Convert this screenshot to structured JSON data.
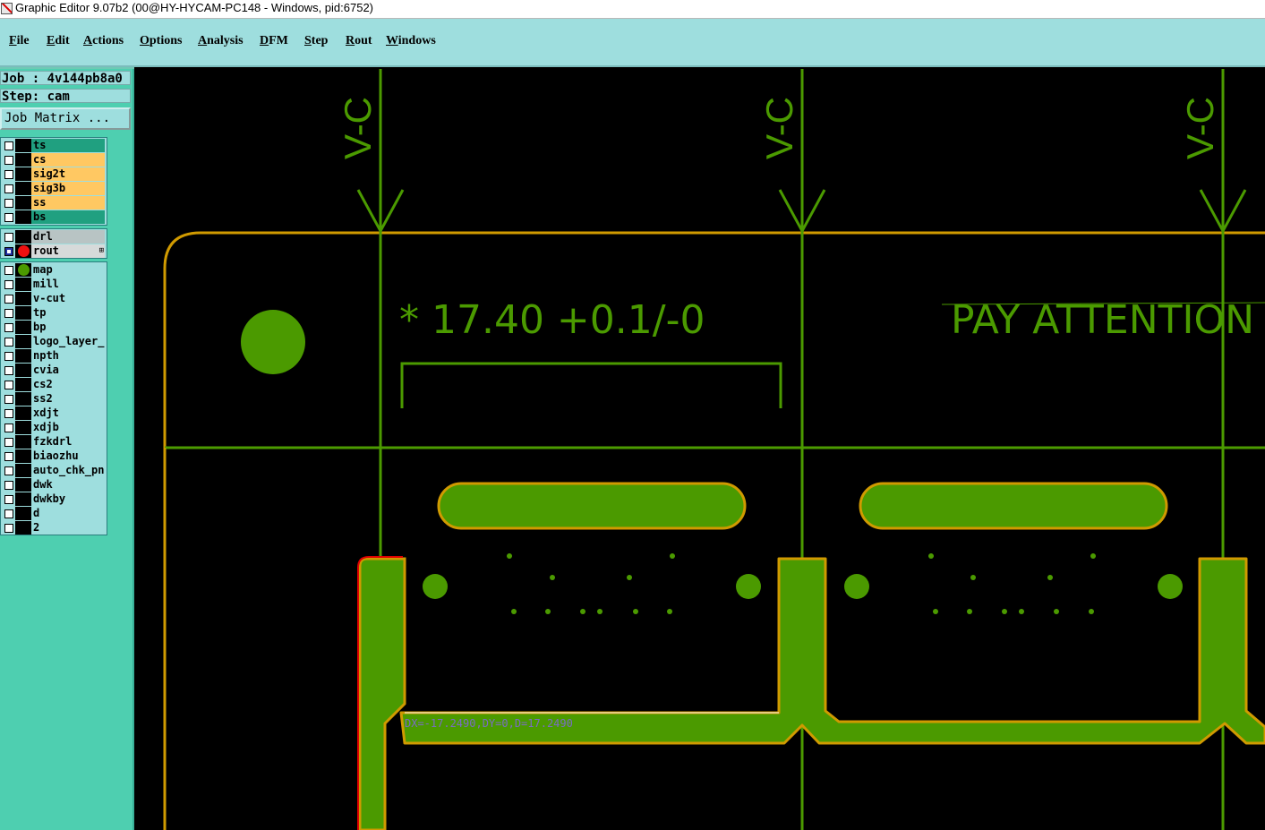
{
  "window": {
    "title": "Graphic Editor 9.07b2 (00@HY-HYCAM-PC148 - Windows, pid:6752)"
  },
  "menu": [
    {
      "label": "File",
      "ul": "F",
      "rest": "ile"
    },
    {
      "label": "Edit",
      "ul": "E",
      "rest": "dit"
    },
    {
      "label": "Actions",
      "ul": "A",
      "rest": "ctions"
    },
    {
      "label": "Options",
      "ul": "O",
      "rest": "ptions"
    },
    {
      "label": "Analysis",
      "ul": "A",
      "rest": "nalysis"
    },
    {
      "label": "DFM",
      "ul": "D",
      "rest": "FM"
    },
    {
      "label": "Step",
      "ul": "S",
      "rest": "tep"
    },
    {
      "label": "Rout",
      "ul": "R",
      "rest": "out"
    },
    {
      "label": "Windows",
      "ul": "W",
      "rest": "indows"
    }
  ],
  "job": {
    "line": "Job : 4v144pb8a0",
    "step_line": "Step: cam",
    "matrix_button": "Job Matrix ..."
  },
  "layers": {
    "board": [
      {
        "name": "ts",
        "bg": "#20a080"
      },
      {
        "name": "cs",
        "bg": "#ffc862"
      },
      {
        "name": "sig2t",
        "bg": "#ffc862"
      },
      {
        "name": "sig3b",
        "bg": "#ffc862"
      },
      {
        "name": "ss",
        "bg": "#ffc862"
      },
      {
        "name": "bs",
        "bg": "#20a080"
      }
    ],
    "drill": [
      {
        "name": "drl",
        "bg": "#b8c4c4",
        "checked": false
      },
      {
        "name": "rout",
        "bg": "#d6dada",
        "checked": true,
        "dot": "#ee1111",
        "indicator": "⊞"
      }
    ],
    "misc": [
      {
        "name": "map",
        "dot": "#4b9a00"
      },
      {
        "name": "mill"
      },
      {
        "name": "v-cut"
      },
      {
        "name": "tp"
      },
      {
        "name": "bp"
      },
      {
        "name": "logo_layer_c"
      },
      {
        "name": "npth"
      },
      {
        "name": "cvia"
      },
      {
        "name": "cs2"
      },
      {
        "name": "ss2"
      },
      {
        "name": "xdjt"
      },
      {
        "name": "xdjb"
      },
      {
        "name": "fzkdrl"
      },
      {
        "name": "biaozhu"
      },
      {
        "name": "auto_chk_pnl"
      },
      {
        "name": "dwk"
      },
      {
        "name": "dwkby"
      },
      {
        "name": "d"
      },
      {
        "name": "2"
      }
    ]
  },
  "canvas": {
    "vcut_label": "V-C",
    "dimension_text": "* 17.40 +0.1/-0",
    "attention_text": "PAY ATTENTION",
    "measure_text": "DX=-17.2490,DY=0,D=17.2490",
    "colors": {
      "feature": "#4b9a00",
      "outline": "#d09a00",
      "highlight": "#e00000",
      "measure": "#7a6cc4",
      "background": "#000000"
    }
  }
}
